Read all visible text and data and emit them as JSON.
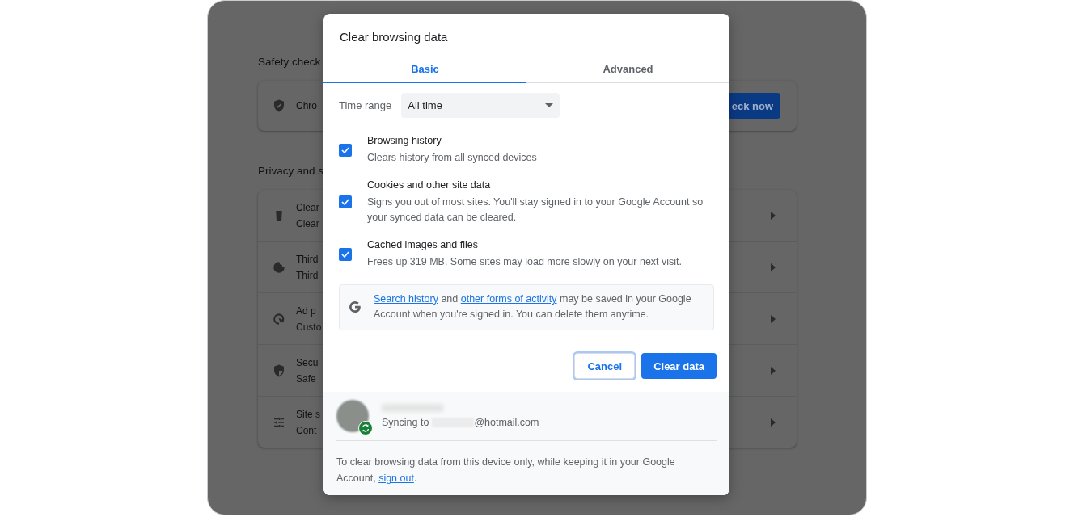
{
  "settings": {
    "sections": [
      {
        "title": "Safety check",
        "rows": [
          {
            "kind": "action",
            "label": "Chro",
            "button": "eck now"
          }
        ]
      },
      {
        "title": "Privacy and s",
        "rows": [
          {
            "kind": "link",
            "label": "Clear",
            "sublabel": "Clear"
          },
          {
            "kind": "link",
            "label": "Third",
            "sublabel": "Third"
          },
          {
            "kind": "link",
            "label": "Ad p",
            "sublabel": "Custo"
          },
          {
            "kind": "link",
            "label": "Secu",
            "sublabel": "Safe"
          },
          {
            "kind": "link",
            "label": "Site s",
            "sublabel": "Cont"
          }
        ]
      }
    ]
  },
  "dialog": {
    "title": "Clear browsing data",
    "tabs": [
      {
        "label": "Basic",
        "selected": true
      },
      {
        "label": "Advanced",
        "selected": false
      }
    ],
    "time_range": {
      "label": "Time range",
      "value": "All time"
    },
    "options": [
      {
        "title": "Browsing history",
        "description": "Clears history from all synced devices",
        "checked": true
      },
      {
        "title": "Cookies and other site data",
        "description": "Signs you out of most sites. You'll stay signed in to your Google Account so your synced data can be cleared.",
        "checked": true
      },
      {
        "title": "Cached images and files",
        "description": "Frees up 319 MB. Some sites may load more slowly on your next visit.",
        "checked": true
      }
    ],
    "info": [
      {
        "text": "Search history",
        "link": true
      },
      {
        "text": " and ",
        "link": false
      },
      {
        "text": "other forms of activity",
        "link": true
      },
      {
        "text": " may be saved in your Google Account when you're signed in. You can delete them anytime.",
        "link": false
      }
    ],
    "buttons": [
      {
        "label": "Cancel",
        "kind": "secondary"
      },
      {
        "label": "Clear data",
        "kind": "primary"
      }
    ],
    "account": {
      "status": "Syncing to",
      "email_suffix": "@hotmail.com",
      "syncing": true
    },
    "note": [
      {
        "text": "To clear browsing data from this device only, while keeping it in your Google Account, ",
        "link": false
      },
      {
        "text": "sign out",
        "link": true
      },
      {
        "text": ".",
        "link": false
      }
    ]
  }
}
